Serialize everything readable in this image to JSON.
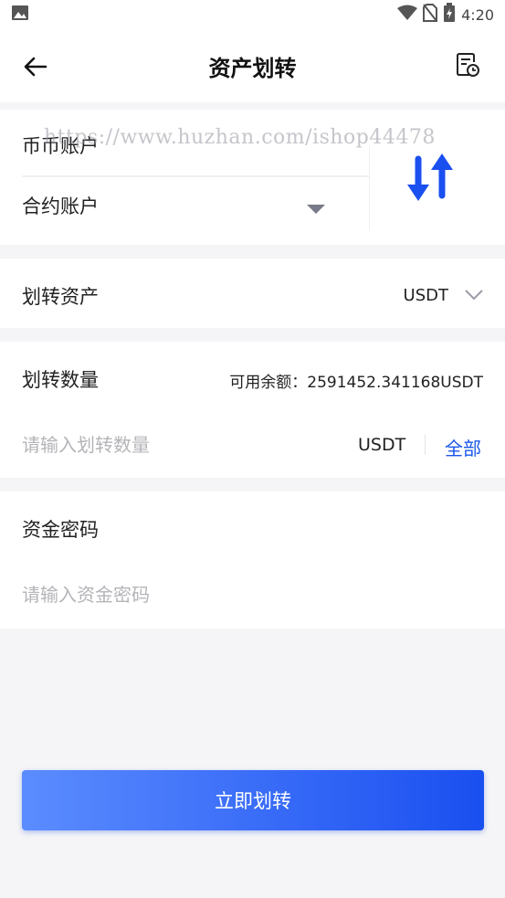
{
  "status_bar": {
    "time": "4:20",
    "icons": [
      "image-icon",
      "wifi-icon",
      "no-sim-icon",
      "battery-icon"
    ]
  },
  "header": {
    "title": "资产划转",
    "back_icon": "arrow-left-icon",
    "record_icon": "record-clock-icon"
  },
  "accounts": {
    "from": "币币账户",
    "to": "合约账户",
    "watermark": "https://www.huzhan.com/ishop44478"
  },
  "asset": {
    "label": "划转资产",
    "value": "USDT"
  },
  "amount": {
    "label": "划转数量",
    "available": "可用余额：2591452.341168USDT",
    "placeholder": "请输入划转数量",
    "unit": "USDT",
    "all_label": "全部"
  },
  "password": {
    "label": "资金密码",
    "placeholder": "请输入资金密码"
  },
  "submit": {
    "label": "立即划转"
  },
  "colors": {
    "accent": "#1a56e8",
    "button_start": "#5b8cff",
    "button_end": "#1a4ff0"
  }
}
